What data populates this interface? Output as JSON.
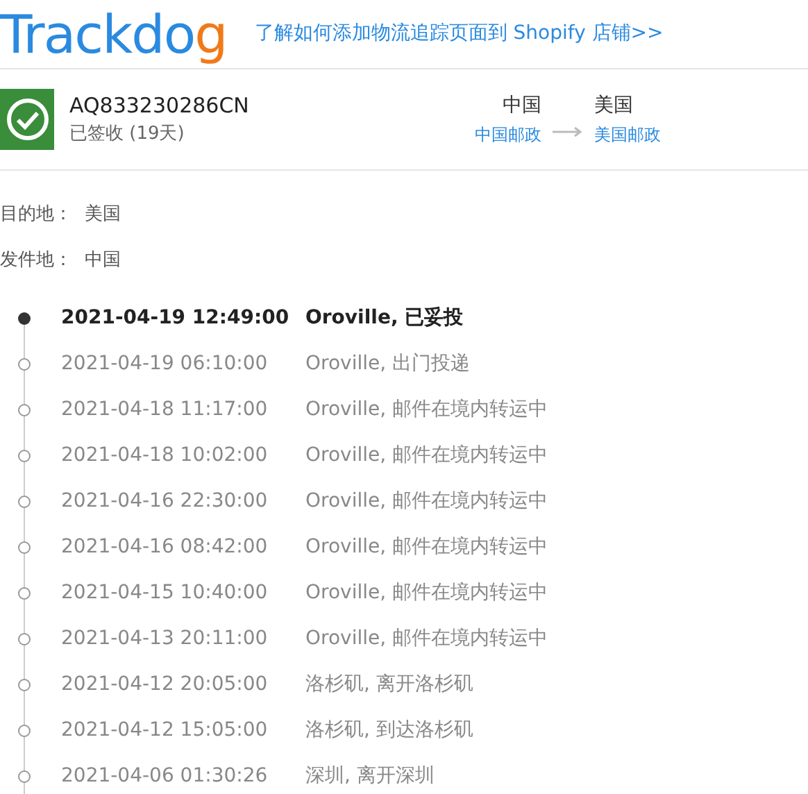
{
  "header": {
    "logo_main": "Trackdo",
    "logo_accent": "g",
    "link": "了解如何添加物流追踪页面到 Shopify 店铺>>"
  },
  "shipment": {
    "tracking_number": "AQ833230286CN",
    "status": "已签收 (19天)",
    "delivered": true,
    "origin": {
      "country": "中国",
      "carrier": "中国邮政"
    },
    "destination": {
      "country": "美国",
      "carrier": "美国邮政"
    }
  },
  "details": [
    {
      "label": "目的地：",
      "value": "美国"
    },
    {
      "label": "发件地：",
      "value": "中国"
    }
  ],
  "events": [
    {
      "time": "2021-04-19 12:49:00",
      "description": "Oroville, 已妥投",
      "current": true
    },
    {
      "time": "2021-04-19 06:10:00",
      "description": "Oroville, 出门投递",
      "current": false
    },
    {
      "time": "2021-04-18 11:17:00",
      "description": "Oroville, 邮件在境内转运中",
      "current": false
    },
    {
      "time": "2021-04-18 10:02:00",
      "description": "Oroville, 邮件在境内转运中",
      "current": false
    },
    {
      "time": "2021-04-16 22:30:00",
      "description": "Oroville, 邮件在境内转运中",
      "current": false
    },
    {
      "time": "2021-04-16 08:42:00",
      "description": "Oroville, 邮件在境内转运中",
      "current": false
    },
    {
      "time": "2021-04-15 10:40:00",
      "description": "Oroville, 邮件在境内转运中",
      "current": false
    },
    {
      "time": "2021-04-13 20:11:00",
      "description": "Oroville, 邮件在境内转运中",
      "current": false
    },
    {
      "time": "2021-04-12 20:05:00",
      "description": "洛杉矶, 离开洛杉矶",
      "current": false
    },
    {
      "time": "2021-04-12 15:05:00",
      "description": "洛杉矶, 到达洛杉矶",
      "current": false
    },
    {
      "time": "2021-04-06 01:30:26",
      "description": "深圳, 离开深圳",
      "current": false
    }
  ]
}
